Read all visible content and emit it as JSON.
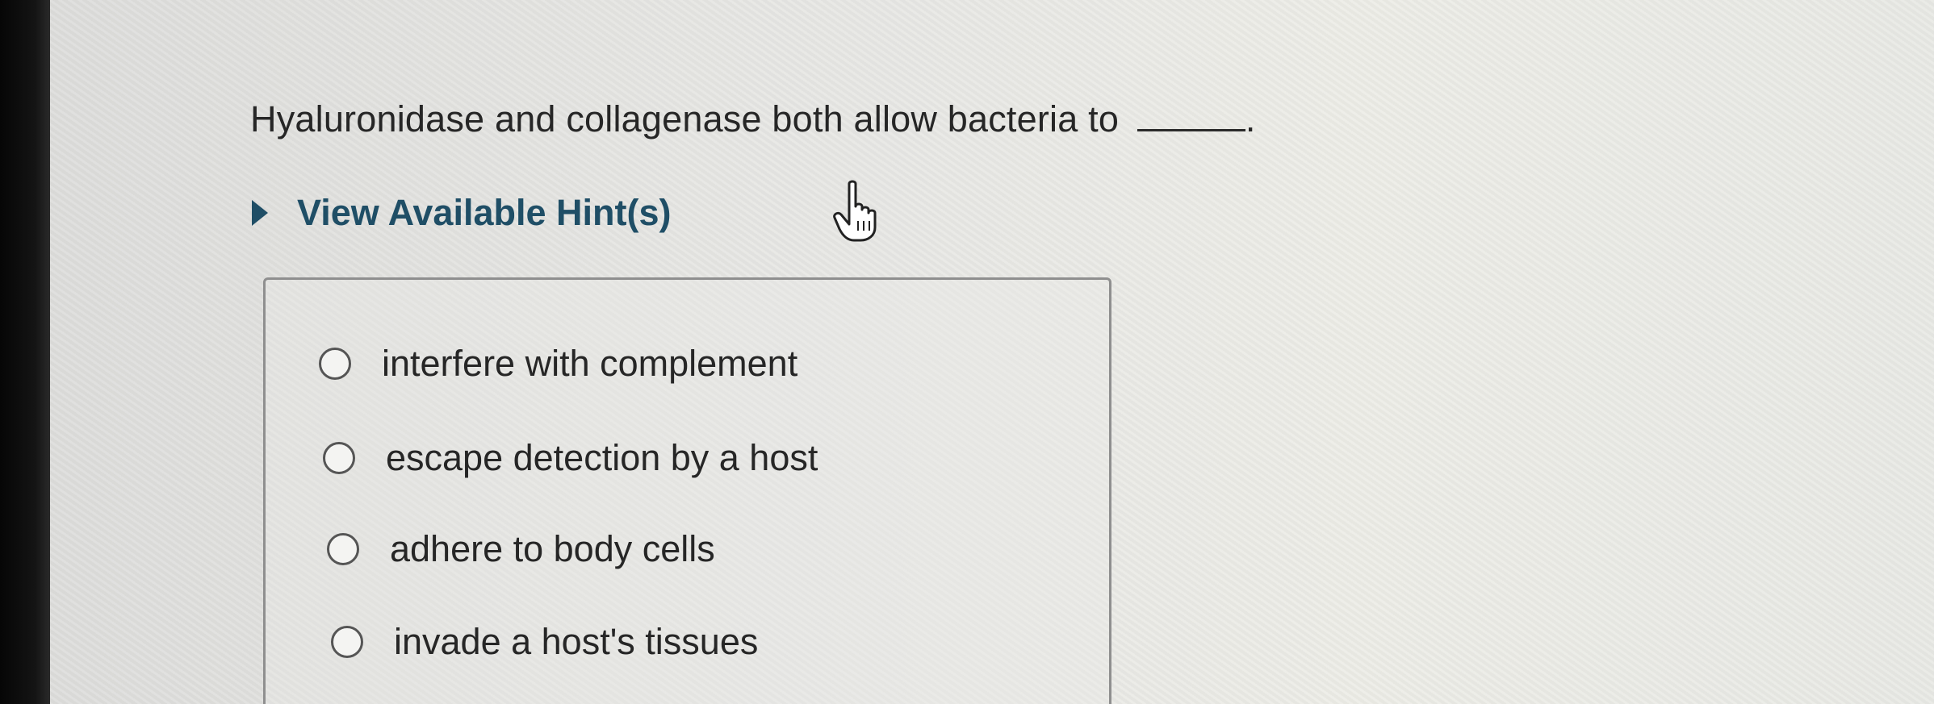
{
  "question": {
    "text": "Hyaluronidase and collagenase both allow bacteria to",
    "end_punctuation": "."
  },
  "hint_toggle": {
    "label": "View Available Hint(s)",
    "icon": "triangle-right-icon"
  },
  "cursor": {
    "icon": "hand-pointer-icon"
  },
  "options": [
    {
      "label": "interfere with complement",
      "selected": false
    },
    {
      "label": "escape detection by a host",
      "selected": false
    },
    {
      "label": "adhere to body cells",
      "selected": false
    },
    {
      "label": "invade a host's tissues",
      "selected": false
    }
  ],
  "colors": {
    "text": "#262626",
    "hint": "#1f4e66",
    "border": "#8f8f8f"
  }
}
